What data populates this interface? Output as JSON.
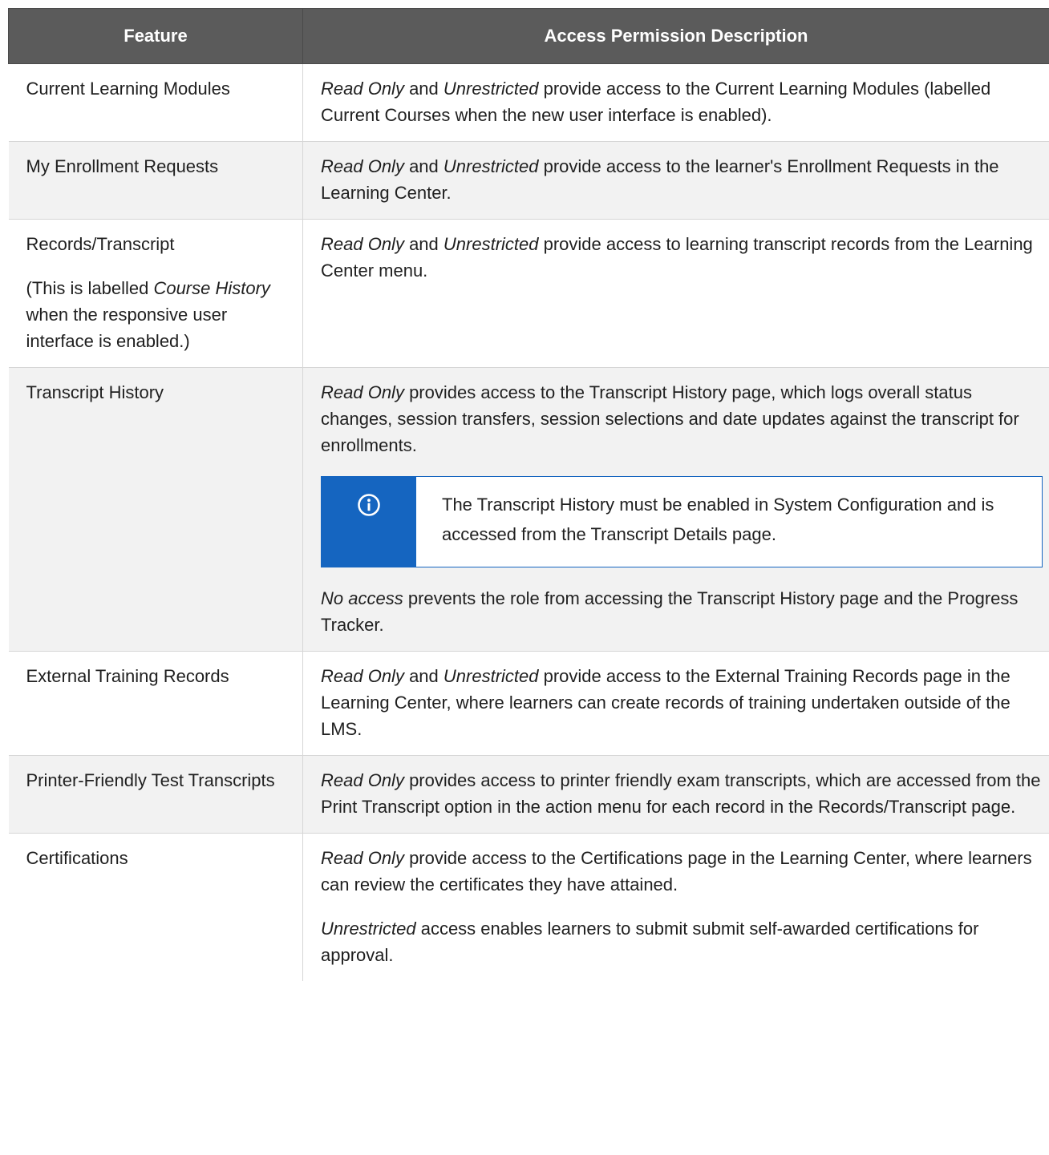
{
  "table": {
    "headers": [
      "Feature",
      "Access Permission Description"
    ],
    "rows": [
      {
        "feature": [
          "Current Learning Modules"
        ],
        "desc": [
          [
            {
              "t": "Read Only",
              "i": true
            },
            {
              "t": " and "
            },
            {
              "t": "Unrestricted",
              "i": true
            },
            {
              "t": " provide access to the Current Learning Modules (labelled Current Courses when the new user interface is enabled)."
            }
          ]
        ]
      },
      {
        "feature": [
          "My Enrollment Requests"
        ],
        "desc": [
          [
            {
              "t": "Read Only",
              "i": true
            },
            {
              "t": " and "
            },
            {
              "t": "Unrestricted",
              "i": true
            },
            {
              "t": " provide access to the learner's Enrollment Requests in the Learning Center."
            }
          ]
        ]
      },
      {
        "feature": [
          "Records/Transcript"
        ],
        "feature_note": [
          {
            "t": "(This is labelled "
          },
          {
            "t": "Course History",
            "i": true
          },
          {
            "t": " when the responsive user interface is enabled.)"
          }
        ],
        "desc": [
          [
            {
              "t": "Read Only",
              "i": true
            },
            {
              "t": " and "
            },
            {
              "t": "Unrestricted",
              "i": true
            },
            {
              "t": " provide access to learning transcript records from the Learning Center menu."
            }
          ]
        ]
      },
      {
        "feature": [
          "Transcript History"
        ],
        "desc": [
          [
            {
              "t": "Read Only",
              "i": true
            },
            {
              "t": " provides access to the Transcript History page, which logs overall status changes, session transfers, session selections and date updates against the transcript for enrollments."
            }
          ]
        ],
        "note": {
          "icon": "info-icon",
          "text": "The Transcript History must be enabled in System Configuration and is accessed from the Transcript Details page."
        },
        "desc_after": [
          [
            {
              "t": "No access",
              "i": true
            },
            {
              "t": " prevents the role from accessing the Transcript History page and the Progress Tracker."
            }
          ]
        ]
      },
      {
        "feature": [
          "External Training Records"
        ],
        "desc": [
          [
            {
              "t": "Read Only",
              "i": true
            },
            {
              "t": " and "
            },
            {
              "t": "Unrestricted",
              "i": true
            },
            {
              "t": " provide access to the External Training Records page in the Learning Center, where learners can create records of training undertaken outside of the LMS."
            }
          ]
        ]
      },
      {
        "feature": [
          "Printer-Friendly Test Transcripts"
        ],
        "desc": [
          [
            {
              "t": "Read Only",
              "i": true
            },
            {
              "t": " provides access to printer friendly exam transcripts, which are accessed from the Print Transcript option in the action menu for each record in the Records/Transcript page."
            }
          ]
        ]
      },
      {
        "feature": [
          "Certifications"
        ],
        "desc": [
          [
            {
              "t": "Read Only",
              "i": true
            },
            {
              "t": " provide access to the Certifications page in the Learning Center, where learners can review the certificates they have attained."
            }
          ],
          [
            {
              "t": "Unrestricted",
              "i": true
            },
            {
              "t": " access enables learners to submit submit self-awarded certifications for approval."
            }
          ]
        ]
      }
    ]
  },
  "colors": {
    "header_bg": "#5b5b5b",
    "alt_row_bg": "#f2f2f2",
    "note_accent": "#1565c0"
  }
}
